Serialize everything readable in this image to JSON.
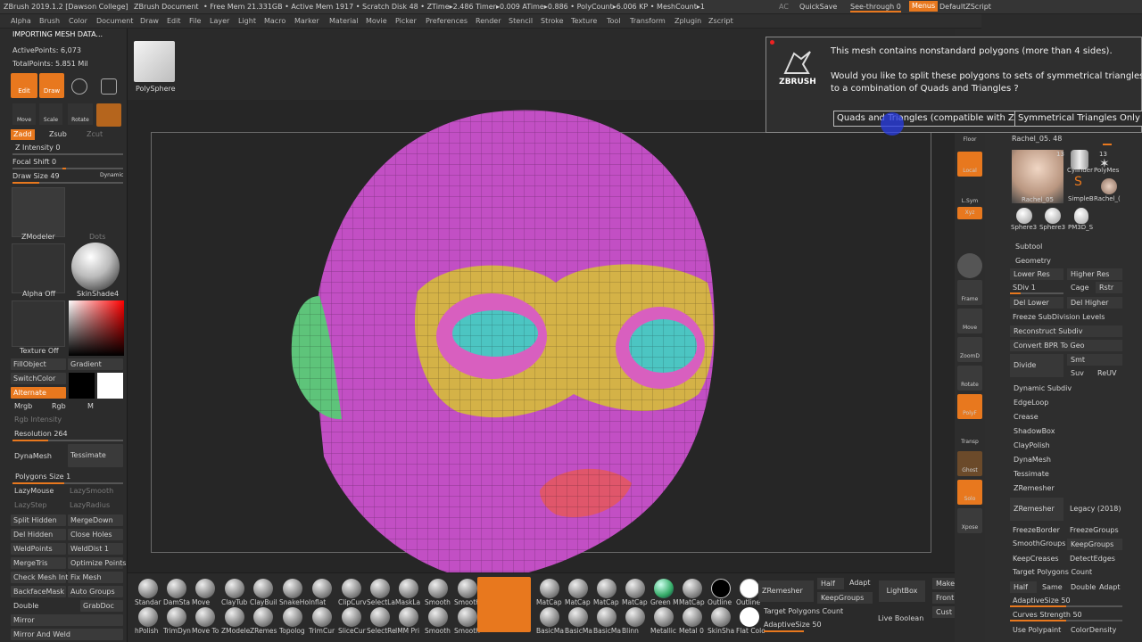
{
  "titlebar": {
    "app": "ZBrush 2019.1.2 [Dawson College]",
    "doc": "ZBrush Document",
    "stats": "• Free Mem 21.331GB • Active Mem 1917 • Scratch Disk 48 • ZTime▸2.486 Timer▸0.009 ATime▸0.886 • PolyCount▸6.006 KP • MeshCount▸1",
    "ac": "AC",
    "quicksave": "QuickSave",
    "seethrough": "See-through  0",
    "menus": "Menus",
    "script": "DefaultZScript"
  },
  "menu": [
    "Alpha",
    "Brush",
    "Color",
    "Document",
    "Draw",
    "Edit",
    "File",
    "Layer",
    "Light",
    "Macro",
    "Marker",
    "Material",
    "Movie",
    "Picker",
    "Preferences",
    "Render",
    "Stencil",
    "Stroke",
    "Texture",
    "Tool",
    "Transform",
    "Zplugin",
    "Zscript"
  ],
  "left": {
    "status": "IMPORTING MESH DATA...",
    "active_points": "ActivePoints: 6,073",
    "total_points": "TotalPoints: 5.851 Mil",
    "edit": "Edit",
    "draw": "Draw",
    "move": "Move",
    "scale": "Scale",
    "rotate": "Rotate",
    "zadd": "Zadd",
    "zsub": "Zsub",
    "zcut": "Zcut",
    "z_intensity": "Z Intensity 0",
    "focal_shift": "Focal Shift 0",
    "draw_size": "Draw Size 49",
    "dynamic": "Dynamic",
    "zmodeler": "ZModeler",
    "dots": "Dots",
    "alpha_off": "Alpha Off",
    "skinshade": "SkinShade4",
    "texture_off": "Texture Off",
    "fillobject": "FillObject",
    "gradient": "Gradient",
    "switchcolor": "SwitchColor",
    "alternate": "Alternate",
    "mrgb": "Mrgb",
    "rgb": "Rgb",
    "m": "M",
    "rgb_intensity": "Rgb Intensity",
    "resolution": "Resolution 264",
    "dynamesh": "DynaMesh",
    "tessimate": "Tessimate",
    "polygons_size": "Polygons Size 1",
    "lazymouse": "LazyMouse",
    "lazysmooth": "LazySmooth",
    "lazystep": "LazyStep",
    "lazyradius": "LazyRadius",
    "split_hidden": "Split Hidden",
    "mergedown": "MergeDown",
    "del_hidden": "Del Hidden",
    "close_holes": "Close Holes",
    "weldpoints": "WeldPoints",
    "welddist": "WeldDist 1",
    "mergetris": "MergeTris",
    "optimize_points": "Optimize Points",
    "check_mesh_int": "Check Mesh Int",
    "fix_mesh": "Fix Mesh",
    "backfacemask": "BackfaceMask",
    "auto_groups": "Auto Groups",
    "double": "Double",
    "grabdoc": "GrabDoc",
    "mirror": "Mirror",
    "mirror_and_weld": "Mirror And Weld"
  },
  "top": {
    "polysphere": "PolySphere"
  },
  "dialog": {
    "line1": "This mesh contains nonstandard polygons (more than 4 sides).",
    "line2": "Would you like to split these polygons to sets of symmetrical triangles? or",
    "line3": "to a combination of Quads and Triangles ?",
    "btn_quads": "Quads and Triangles (compatible with Z2)",
    "btn_sym": "Symmetrical Triangles Only",
    "logo": "ZBRUSH"
  },
  "rightshelf": [
    "Floor",
    "Local",
    "L.Sym",
    "Xyz",
    "",
    "",
    "Frame",
    "Move",
    "ZoomD",
    "Rotate",
    "PolyF",
    "Transp",
    "Ghost",
    "Solo",
    "Xpose"
  ],
  "tool": {
    "title": "Tool",
    "rachel": "Rachel_05. 48",
    "thumb_count": "13",
    "thumb_count2": "13",
    "thumbs": [
      "Rachel_05",
      "Cylinder",
      "PolyMes",
      "SimpleB",
      "Rachel_(",
      "Sphere3",
      "Sphere3",
      "PM3D_S"
    ],
    "subtool": "Subtool",
    "geometry": "Geometry",
    "lower_res": "Lower Res",
    "higher_res": "Higher Res",
    "sdiv": "SDiv 1",
    "cage": "Cage",
    "rstr": "Rstr",
    "del_lower": "Del Lower",
    "del_higher": "Del Higher",
    "freeze_subdiv": "Freeze SubDivision Levels",
    "reconstruct": "Reconstruct Subdiv",
    "convert_bpr": "Convert BPR To Geo",
    "divide": "Divide",
    "smt": "Smt",
    "suv": "Suv",
    "reuv": "ReUV",
    "dynamic_subdiv": "Dynamic Subdiv",
    "edgeloop": "EdgeLoop",
    "crease": "Crease",
    "shadowbox": "ShadowBox",
    "claypolish": "ClayPolish",
    "dynamesh": "DynaMesh",
    "tessimate": "Tessimate",
    "zremesher_hdr": "ZRemesher",
    "zremesher": "ZRemesher",
    "legacy": "Legacy (2018)",
    "freezeborder": "FreezeBorder",
    "freezegroups": "FreezeGroups",
    "smoothgroups": "SmoothGroups",
    "keepgroups": "KeepGroups",
    "keepcreases": "KeepCreases",
    "detectedges": "DetectEdges",
    "target_poly": "Target Polygons Count",
    "half": "Half",
    "same": "Same",
    "double": "Double",
    "adapt": "Adapt",
    "adaptivesize": "AdaptiveSize 50",
    "curves_strength": "Curves Strength 50",
    "use_polypaint": "Use Polypaint",
    "colordensity": "ColorDensity"
  },
  "bottom": {
    "row1": [
      "Standar",
      "DamSta",
      "Move",
      "ClayTub",
      "ClayBuil",
      "SnakeHo",
      "Inflat",
      "ClipCurv",
      "SelectLa",
      "MaskLa",
      "Smooth",
      "Smooth",
      "",
      "MatCap",
      "MatCap",
      "MatCap",
      "MatCap",
      "Green M",
      "MatCap",
      "Outline",
      "Outline"
    ],
    "row2": [
      "hPolish",
      "TrimDyn",
      "Move To",
      "ZModele",
      "ZRemes",
      "Topolog",
      "TrimCur",
      "SliceCur",
      "SelectRe",
      "IMM Pri",
      "Smooth",
      "Smooth",
      "",
      "BasicMa",
      "BasicMa",
      "BasicMa",
      "Blinn",
      "Metallic",
      "Metal 0",
      "SkinSha",
      "Flat Colo"
    ],
    "zremesher": "ZRemesher",
    "half": "Half",
    "adapt": "Adapt",
    "keepgroups": "KeepGroups",
    "target": "Target Polygons Count",
    "adaptivesize": "AdaptiveSize 50",
    "lightbox": "LightBox",
    "live_boolean": "Live Boolean",
    "make": "Make",
    "front": "Front",
    "cust": "Cust"
  },
  "colors": {
    "accent": "#e8781e",
    "panel": "#2c2c2c",
    "skin": "#c24fc4",
    "mask": "#d4b247",
    "eye": "#4cc5c2",
    "ear": "#5ec47a",
    "lips": "#e0566b"
  }
}
